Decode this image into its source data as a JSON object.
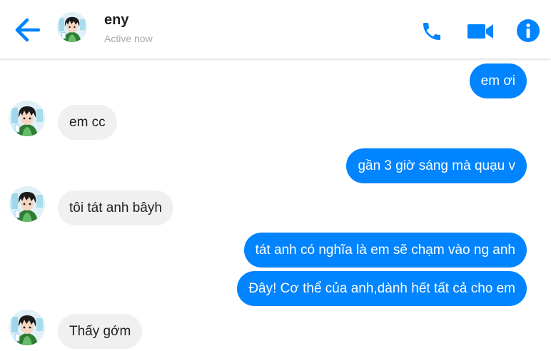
{
  "header": {
    "contact_name": "eny",
    "status": "Active now",
    "back_icon": "back-arrow-icon",
    "call_icon": "phone-icon",
    "video_icon": "video-camera-icon",
    "info_icon": "info-icon"
  },
  "colors": {
    "accent": "#0084ff",
    "received_bubble": "#f0f0f0",
    "text_dark": "#1c1e21",
    "status_text": "#a8a8a8"
  },
  "messages": [
    {
      "direction": "sent",
      "text": "em ơi"
    },
    {
      "direction": "received",
      "text": "em cc"
    },
    {
      "direction": "sent",
      "text": "gần 3 giờ sáng mà quạu v"
    },
    {
      "direction": "received",
      "text": "tôi tát anh bâyh"
    },
    {
      "direction": "sent",
      "text": "tát anh có nghĩa là em sẽ chạm vào ng anh"
    },
    {
      "direction": "sent",
      "text": "Đây! Cơ thể của anh,dành hết tất cả cho em"
    },
    {
      "direction": "received",
      "text": "Thấy gớm"
    }
  ]
}
